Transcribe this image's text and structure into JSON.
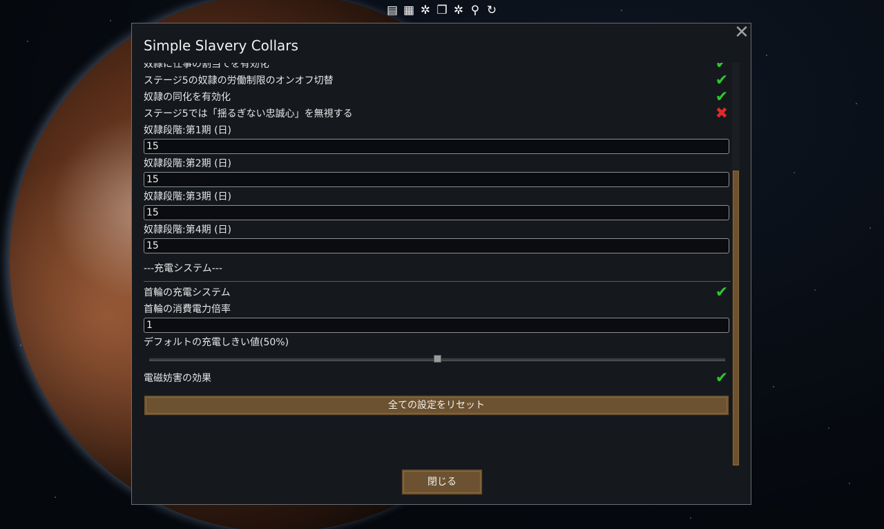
{
  "toolbar": {
    "icons": [
      "list-icon",
      "table-icon",
      "puzzle-icon",
      "stack-icon",
      "puzzle-alt-icon",
      "search-icon",
      "refresh-icon"
    ],
    "glyphs": [
      "▤",
      "▦",
      "✲",
      "❐",
      "✲",
      "⚲",
      "↻"
    ]
  },
  "dialog": {
    "title": "Simple Slavery Collars",
    "close_glyph": "✕",
    "options": [
      {
        "label": "奴隷に仕事の割当てを有効化",
        "checked": true
      },
      {
        "label": "ステージ5の奴隷の労働制限のオンオフ切替",
        "checked": true
      },
      {
        "label": "奴隷の同化を有効化",
        "checked": true
      },
      {
        "label": "ステージ5では「揺るぎない忠誠心」を無視する",
        "checked": false
      }
    ],
    "stages": [
      {
        "label": "奴隷段階:第1期 (日)",
        "value": "15"
      },
      {
        "label": "奴隷段階:第2期 (日)",
        "value": "15"
      },
      {
        "label": "奴隷段階:第3期 (日)",
        "value": "15"
      },
      {
        "label": "奴隷段階:第4期 (日)",
        "value": "15"
      }
    ],
    "charging_section": "---充電システム---",
    "collar_charging": {
      "label": "首輪の充電システム",
      "checked": true
    },
    "power_multiplier": {
      "label": "首輪の消費電力倍率",
      "value": "1"
    },
    "threshold": {
      "label": "デフォルトの充電しきい値(50%)",
      "fraction": 0.5
    },
    "emp": {
      "label": "電磁妨害の効果",
      "checked": true
    },
    "reset_label": "全ての設定をリセット",
    "close_label": "閉じる",
    "check_glyph": "✔",
    "cross_glyph": "✖"
  }
}
